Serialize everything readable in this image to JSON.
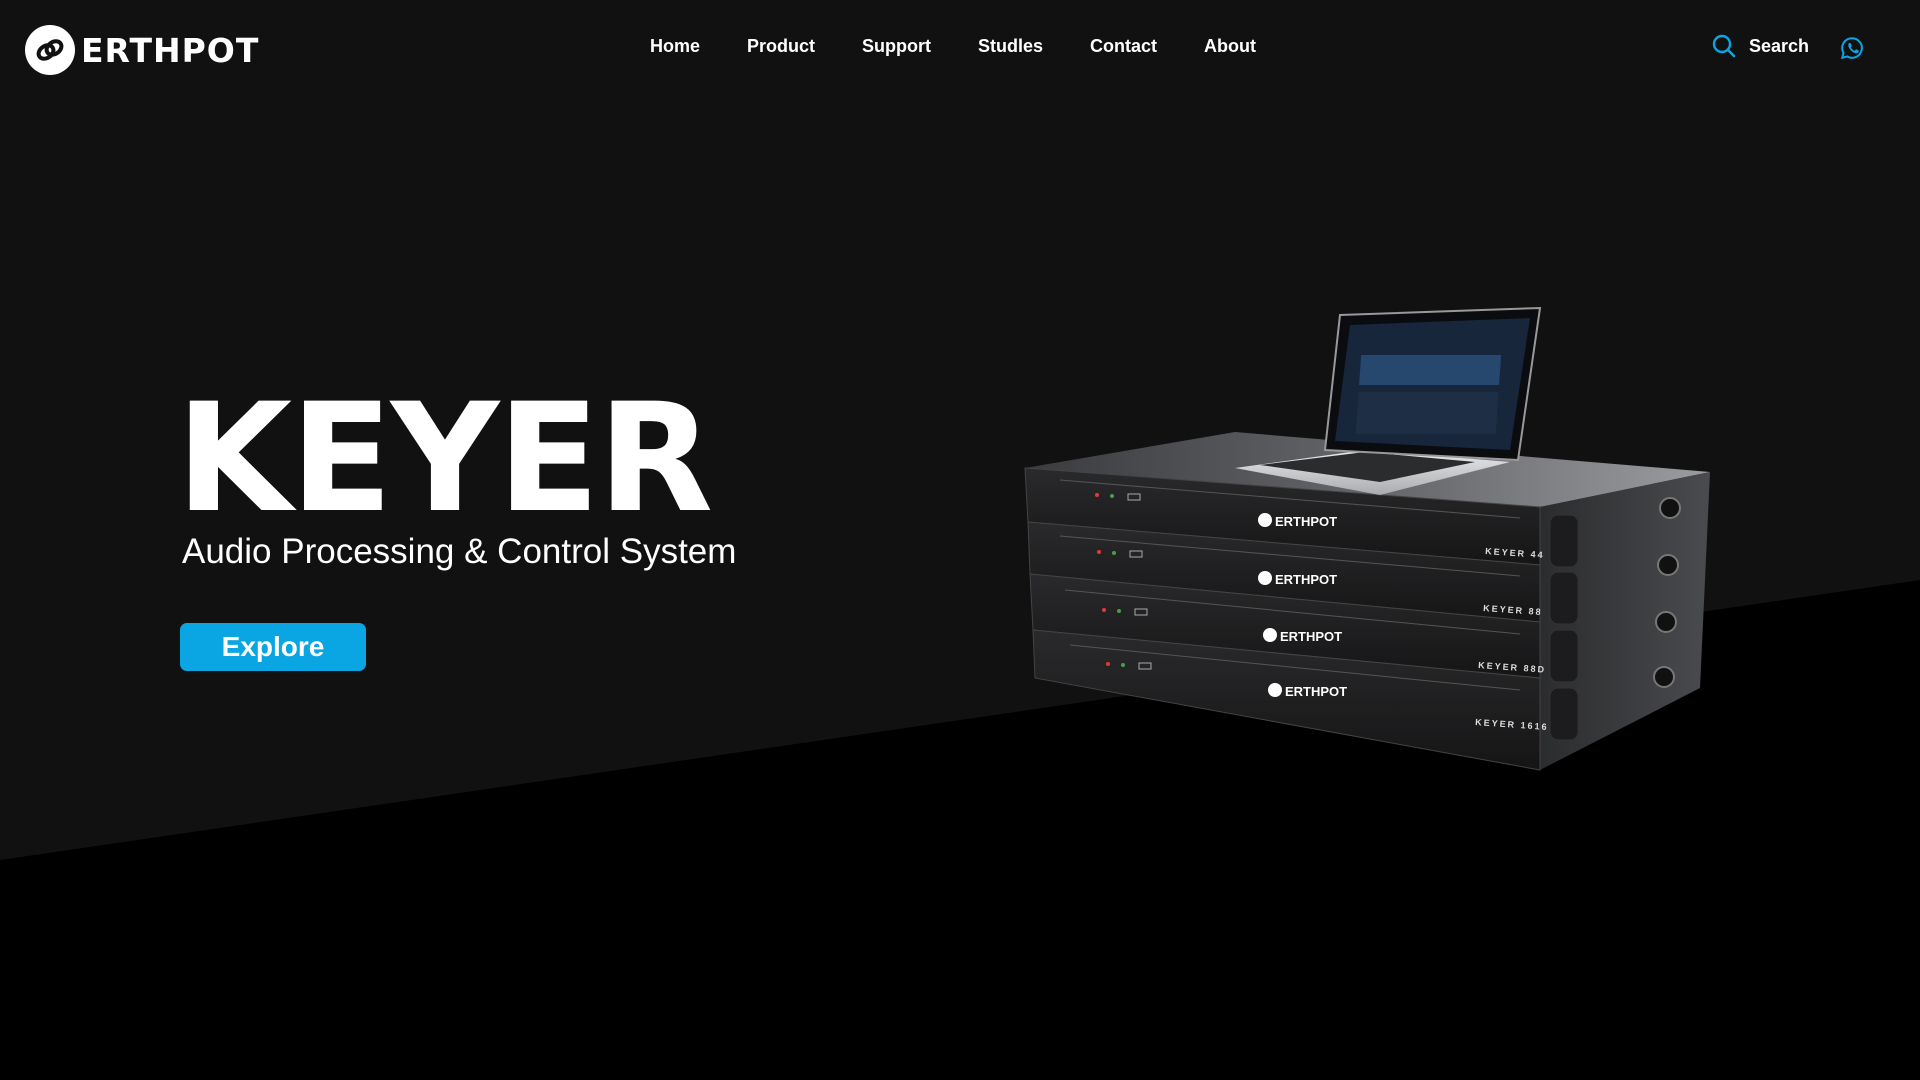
{
  "brand": {
    "name": "ERTHPOT"
  },
  "nav": {
    "items": [
      {
        "label": "Home"
      },
      {
        "label": "Product"
      },
      {
        "label": "Support"
      },
      {
        "label": "Studles"
      },
      {
        "label": "Contact"
      },
      {
        "label": "About"
      }
    ]
  },
  "search": {
    "label": "Search",
    "icon": "search-icon"
  },
  "social": {
    "icon": "whatsapp-icon"
  },
  "hero": {
    "title": "KEYER",
    "subtitle": "Audio Processing & Control System",
    "cta_label": "Explore"
  },
  "product": {
    "units": [
      {
        "brand": "ERTHPOT",
        "model": "KEYER 44"
      },
      {
        "brand": "ERTHPOT",
        "model": "KEYER 88"
      },
      {
        "brand": "ERTHPOT",
        "model": "KEYER 88D"
      },
      {
        "brand": "ERTHPOT",
        "model": "KEYER 1616"
      }
    ]
  },
  "colors": {
    "accent": "#0aa6e3",
    "background_upper": "#111112",
    "background_lower": "#000000",
    "text": "#ffffff"
  }
}
